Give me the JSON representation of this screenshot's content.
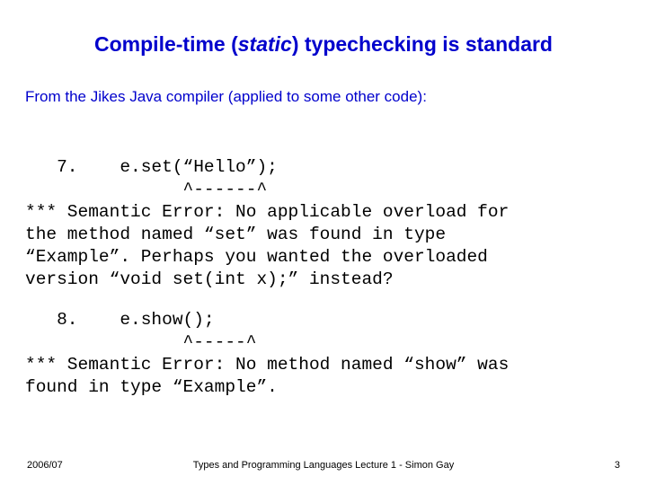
{
  "slide": {
    "title_part1": "Compile-time (",
    "title_italic": "static",
    "title_part2": ") typechecking is standard",
    "intro": "From the Jikes Java compiler (applied to some other code):",
    "code_block_1": "   7.    e.set(“Hello”);\n               ^------^\n*** Semantic Error: No applicable overload for\nthe method named “set” was found in type\n“Example”. Perhaps you wanted the overloaded\nversion “void set(int x);” instead?",
    "code_block_2": "   8.    e.show();\n               ^-----^\n*** Semantic Error: No method named “show” was\nfound in type “Example”.",
    "footer_date": "2006/07",
    "footer_center": "Types and Programming Languages Lecture 1 - Simon Gay",
    "footer_page": "3",
    "accent_color": "#0000cc"
  }
}
